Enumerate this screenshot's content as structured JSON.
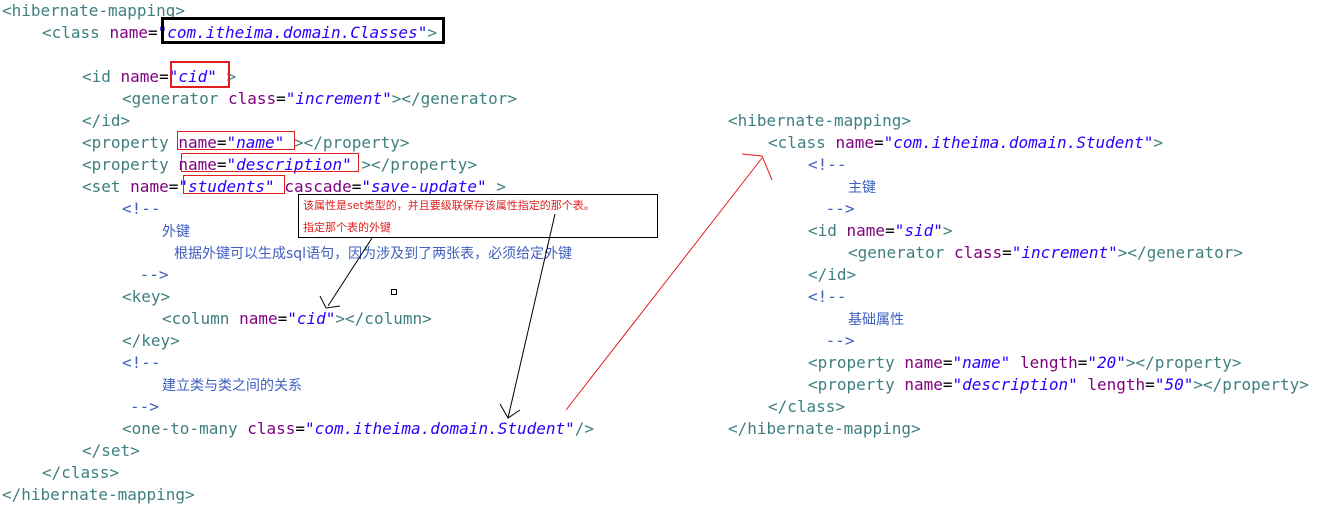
{
  "left": {
    "lines": [
      [
        {
          "t": "tag",
          "v": "<hibernate-mapping>"
        }
      ],
      [
        {
          "t": "tag",
          "v": "<class "
        },
        {
          "t": "attr",
          "v": "name"
        },
        {
          "t": "eq",
          "v": "="
        },
        {
          "t": "val",
          "v": "\"com.itheima.domain.Classes\""
        },
        {
          "t": "tag",
          "v": ">"
        }
      ],
      [],
      [
        {
          "t": "tag",
          "v": "<id "
        },
        {
          "t": "attr",
          "v": "name"
        },
        {
          "t": "eq",
          "v": "="
        },
        {
          "t": "val",
          "v": "\"cid\""
        },
        {
          "t": "tag",
          "v": " >"
        }
      ],
      [
        {
          "t": "tag",
          "v": "<generator "
        },
        {
          "t": "attr",
          "v": "class"
        },
        {
          "t": "eq",
          "v": "="
        },
        {
          "t": "val",
          "v": "\"increment\""
        },
        {
          "t": "tag",
          "v": "></generator>"
        }
      ],
      [
        {
          "t": "tag",
          "v": "</id>"
        }
      ],
      [
        {
          "t": "tag",
          "v": "<property "
        },
        {
          "t": "attr",
          "v": "name"
        },
        {
          "t": "eq",
          "v": "="
        },
        {
          "t": "val",
          "v": "\"name\""
        },
        {
          "t": "tag",
          "v": " ></property>"
        }
      ],
      [
        {
          "t": "tag",
          "v": "<property "
        },
        {
          "t": "attr",
          "v": "name"
        },
        {
          "t": "eq",
          "v": "="
        },
        {
          "t": "val",
          "v": "\"description\""
        },
        {
          "t": "tag",
          "v": " ></property>"
        }
      ],
      [
        {
          "t": "tag",
          "v": "<set "
        },
        {
          "t": "attr",
          "v": "name"
        },
        {
          "t": "eq",
          "v": "="
        },
        {
          "t": "val",
          "v": "\"students\""
        },
        {
          "t": "tag",
          "v": " "
        },
        {
          "t": "attr",
          "v": "cascade"
        },
        {
          "t": "eq",
          "v": "="
        },
        {
          "t": "val",
          "v": "\"save-update\""
        },
        {
          "t": "tag",
          "v": " >"
        }
      ],
      [
        {
          "t": "comment",
          "v": "<!--"
        }
      ],
      [
        {
          "t": "cjk",
          "v": "外键"
        }
      ],
      [
        {
          "t": "cjk",
          "v": "根据外键可以生成sql语句，因为涉及到了两张表，必须给定外键"
        }
      ],
      [
        {
          "t": "comment",
          "v": " -->"
        }
      ],
      [
        {
          "t": "tag",
          "v": "<key>"
        }
      ],
      [
        {
          "t": "tag",
          "v": "<column "
        },
        {
          "t": "attr",
          "v": "name"
        },
        {
          "t": "eq",
          "v": "="
        },
        {
          "t": "val",
          "v": "\"cid\""
        },
        {
          "t": "tag",
          "v": "></column>"
        }
      ],
      [
        {
          "t": "tag",
          "v": "</key>"
        }
      ],
      [
        {
          "t": "comment",
          "v": "<!--"
        }
      ],
      [
        {
          "t": "cjk",
          "v": "建立类与类之间的关系"
        }
      ],
      [
        {
          "t": "comment",
          "v": "-->"
        }
      ],
      [
        {
          "t": "tag",
          "v": "<one-to-many "
        },
        {
          "t": "attr",
          "v": "class"
        },
        {
          "t": "eq",
          "v": "="
        },
        {
          "t": "val",
          "v": "\"com.itheima.domain.Student\""
        },
        {
          "t": "tag",
          "v": "/>"
        }
      ],
      [
        {
          "t": "tag",
          "v": "</set>"
        }
      ],
      [
        {
          "t": "tag",
          "v": "</class>"
        }
      ],
      [
        {
          "t": "tag",
          "v": "</hibernate-mapping>"
        }
      ]
    ]
  },
  "right": {
    "lines": [
      [
        {
          "t": "tag",
          "v": "<hibernate-mapping>"
        }
      ],
      [
        {
          "t": "tag",
          "v": "<class "
        },
        {
          "t": "attr",
          "v": "name"
        },
        {
          "t": "eq",
          "v": "="
        },
        {
          "t": "val",
          "v": "\"com.itheima.domain.Student\""
        },
        {
          "t": "tag",
          "v": ">"
        }
      ],
      [
        {
          "t": "comment",
          "v": "<!--"
        }
      ],
      [
        {
          "t": "cjk",
          "v": "主键"
        }
      ],
      [
        {
          "t": "comment",
          "v": " -->"
        }
      ],
      [
        {
          "t": "tag",
          "v": "<id "
        },
        {
          "t": "attr",
          "v": "name"
        },
        {
          "t": "eq",
          "v": "="
        },
        {
          "t": "val",
          "v": "\"sid\""
        },
        {
          "t": "tag",
          "v": ">"
        }
      ],
      [
        {
          "t": "tag",
          "v": "<generator "
        },
        {
          "t": "attr",
          "v": "class"
        },
        {
          "t": "eq",
          "v": "="
        },
        {
          "t": "val",
          "v": "\"increment\""
        },
        {
          "t": "tag",
          "v": "></generator>"
        }
      ],
      [
        {
          "t": "tag",
          "v": "</id>"
        }
      ],
      [
        {
          "t": "comment",
          "v": "<!--"
        }
      ],
      [
        {
          "t": "cjk",
          "v": "基础属性"
        }
      ],
      [
        {
          "t": "comment",
          "v": " -->"
        }
      ],
      [
        {
          "t": "tag",
          "v": "<property "
        },
        {
          "t": "attr",
          "v": "name"
        },
        {
          "t": "eq",
          "v": "="
        },
        {
          "t": "val",
          "v": "\"name\""
        },
        {
          "t": "tag",
          "v": " "
        },
        {
          "t": "attr",
          "v": "length"
        },
        {
          "t": "eq",
          "v": "="
        },
        {
          "t": "val",
          "v": "\"20\""
        },
        {
          "t": "tag",
          "v": "></property>"
        }
      ],
      [
        {
          "t": "tag",
          "v": "<property "
        },
        {
          "t": "attr",
          "v": "name"
        },
        {
          "t": "eq",
          "v": "="
        },
        {
          "t": "val",
          "v": "\"description\""
        },
        {
          "t": "tag",
          "v": " "
        },
        {
          "t": "attr",
          "v": "length"
        },
        {
          "t": "eq",
          "v": "="
        },
        {
          "t": "val",
          "v": "\"50\""
        },
        {
          "t": "tag",
          "v": "></property>"
        }
      ],
      [
        {
          "t": "tag",
          "v": "</class>"
        }
      ],
      [
        {
          "t": "tag",
          "v": "</hibernate-mapping>"
        }
      ]
    ]
  },
  "note": {
    "line1": "该属性是set类型的，并且要级联保存该属性指定的那个表。",
    "line2": "指定那个表的外键"
  },
  "colors": {
    "tag": "#3f7f7f",
    "attr": "#7f007f",
    "value": "#2a00ff",
    "comment": "#3f5fbf",
    "highlight_red": "#e02020",
    "highlight_black": "#000000"
  }
}
